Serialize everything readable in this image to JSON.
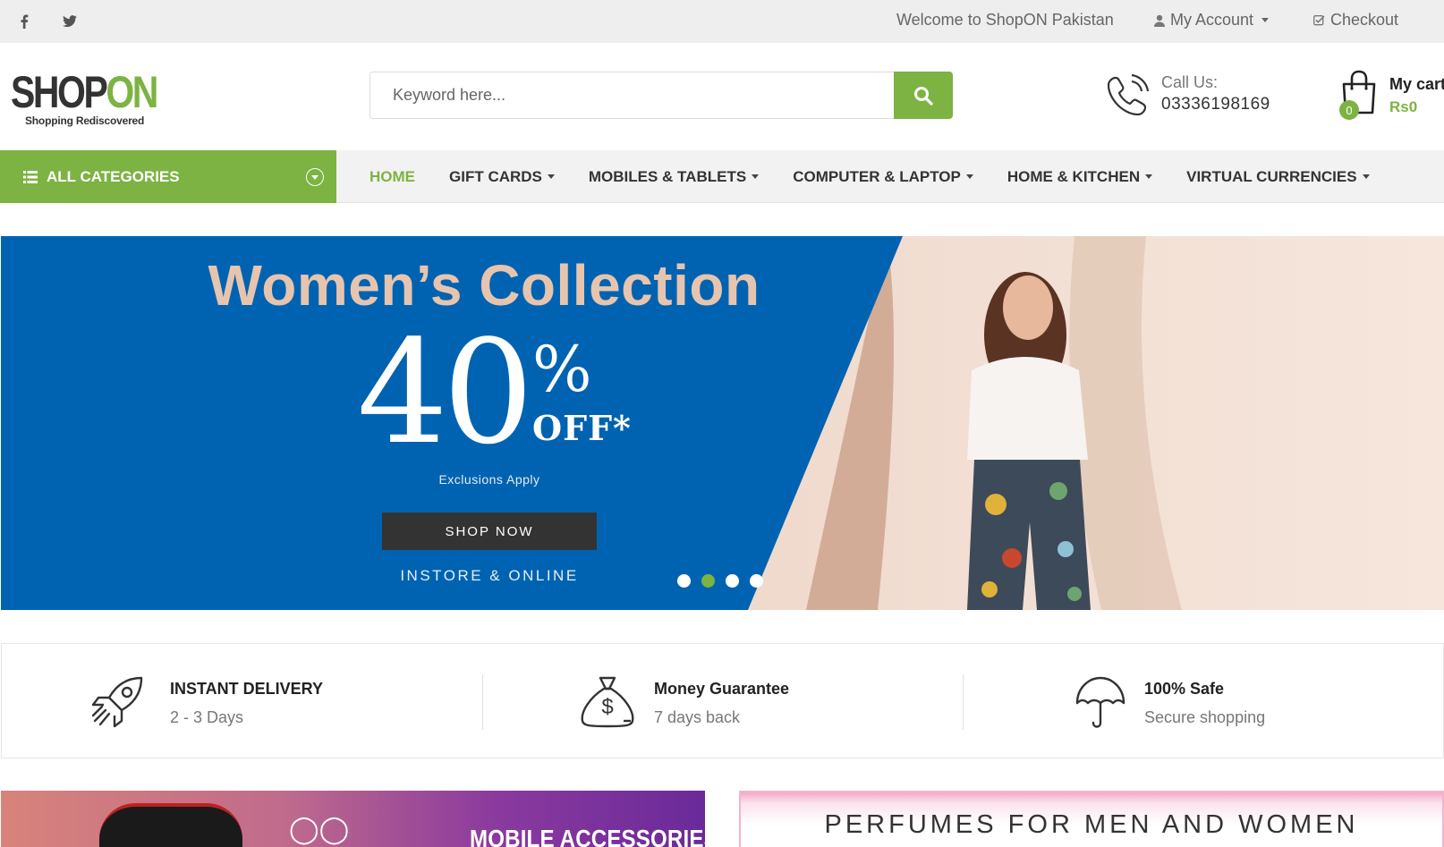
{
  "topbar": {
    "welcome": "Welcome to ShopON Pakistan",
    "my_account": "My Account",
    "checkout": "Checkout"
  },
  "logo": {
    "brand_a": "SHOP",
    "brand_b": "ON",
    "tagline": "Shopping Rediscovered"
  },
  "search": {
    "placeholder": "Keyword here..."
  },
  "contact": {
    "label": "Call Us:",
    "phone": "03336198169"
  },
  "cart": {
    "count": "0",
    "label": "My cart",
    "total": "Rs0"
  },
  "nav": {
    "all_categories": "ALL CATEGORIES",
    "items": [
      {
        "label": "HOME",
        "dropdown": false
      },
      {
        "label": "GIFT CARDS",
        "dropdown": true
      },
      {
        "label": "MOBILES & TABLETS",
        "dropdown": true
      },
      {
        "label": "COMPUTER & LAPTOP",
        "dropdown": true
      },
      {
        "label": "HOME & KITCHEN",
        "dropdown": true
      },
      {
        "label": "VIRTUAL CURRENCIES",
        "dropdown": true
      }
    ]
  },
  "hero": {
    "title": "Women’s Collection",
    "percent_number": "40",
    "percent_sign": "%",
    "off": "OFF*",
    "exclusions": "Exclusions Apply",
    "button": "SHOP NOW",
    "footer": "INSTORE & ONLINE",
    "slides_total": 4,
    "active_slide": 2
  },
  "features": [
    {
      "icon": "rocket-icon",
      "title": "INSTANT DELIVERY",
      "subtitle": "2 - 3 Days"
    },
    {
      "icon": "money-bag-icon",
      "title": "Money Guarantee",
      "subtitle": "7 days back"
    },
    {
      "icon": "umbrella-icon",
      "title": "100% Safe",
      "subtitle": "Secure shopping"
    }
  ],
  "banners": {
    "left": "MOBILE ACCESSORIES",
    "right": "PERFUMES FOR MEN AND WOMEN"
  },
  "colors": {
    "accent": "#7cb342",
    "hero_blue": "#0063b1",
    "topbar": "#eeeeee"
  }
}
